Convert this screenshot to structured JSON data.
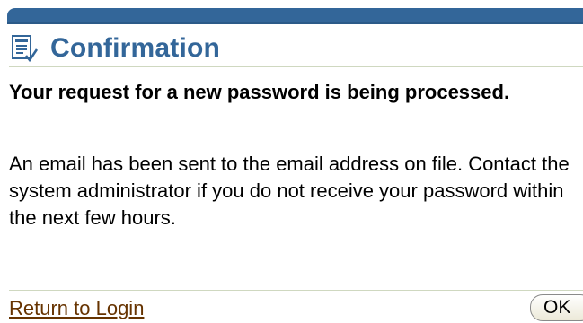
{
  "header": {
    "title": "Confirmation",
    "icon": "confirmation-document-icon"
  },
  "message": {
    "heading": "Your request for a new password is being processed.",
    "body": "An email has been sent to the email address on file. Contact the system administrator if you do not receive your password within the next few hours."
  },
  "footer": {
    "return_link": "Return to Login",
    "ok_button": "OK"
  },
  "colors": {
    "brand_bar": "#336699",
    "title": "#336699",
    "link": "#663300",
    "rule": "#cfd8c0"
  }
}
